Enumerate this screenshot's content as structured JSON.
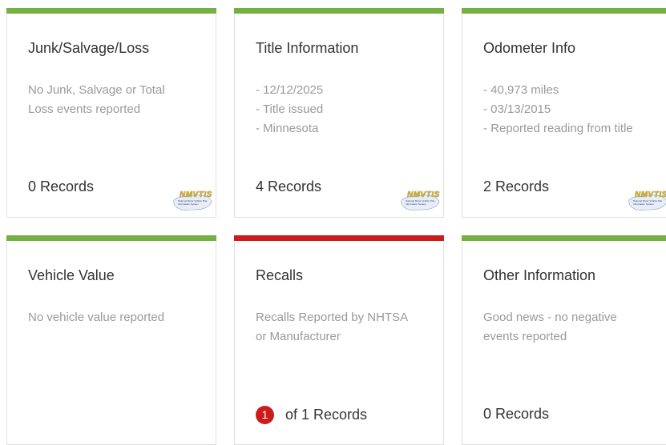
{
  "colors": {
    "good": "#75b043",
    "bad": "#cc1b1b"
  },
  "cards": [
    {
      "title": "Junk/Salvage/Loss",
      "lines": [
        "No Junk, Salvage or Total",
        "Loss events reported"
      ],
      "records": "0 Records",
      "status": "good"
    },
    {
      "title": "Title Information",
      "lines": [
        "- 12/12/2025",
        "- Title issued",
        "- Minnesota"
      ],
      "records": "4 Records",
      "status": "good"
    },
    {
      "title": "Odometer Info",
      "lines": [
        "- 40,973 miles",
        "- 03/13/2015",
        "- Reported reading from title"
      ],
      "records": "2 Records",
      "status": "good"
    },
    {
      "title": "Vehicle Value",
      "lines": [
        "No vehicle value reported"
      ],
      "records": "",
      "status": "good"
    },
    {
      "title": "Recalls",
      "lines": [
        "Recalls Reported by NHTSA",
        "or Manufacturer"
      ],
      "badge": "1",
      "records": "of  1 Records",
      "status": "bad"
    },
    {
      "title": "Other Information",
      "lines": [
        "Good news - no negative",
        "events reported"
      ],
      "records": "0 Records",
      "status": "good"
    }
  ],
  "logo": {
    "name": "nmvtis-logo",
    "text": "NMVTIS",
    "subtitle": "National Motor Vehicle Title Information System"
  }
}
